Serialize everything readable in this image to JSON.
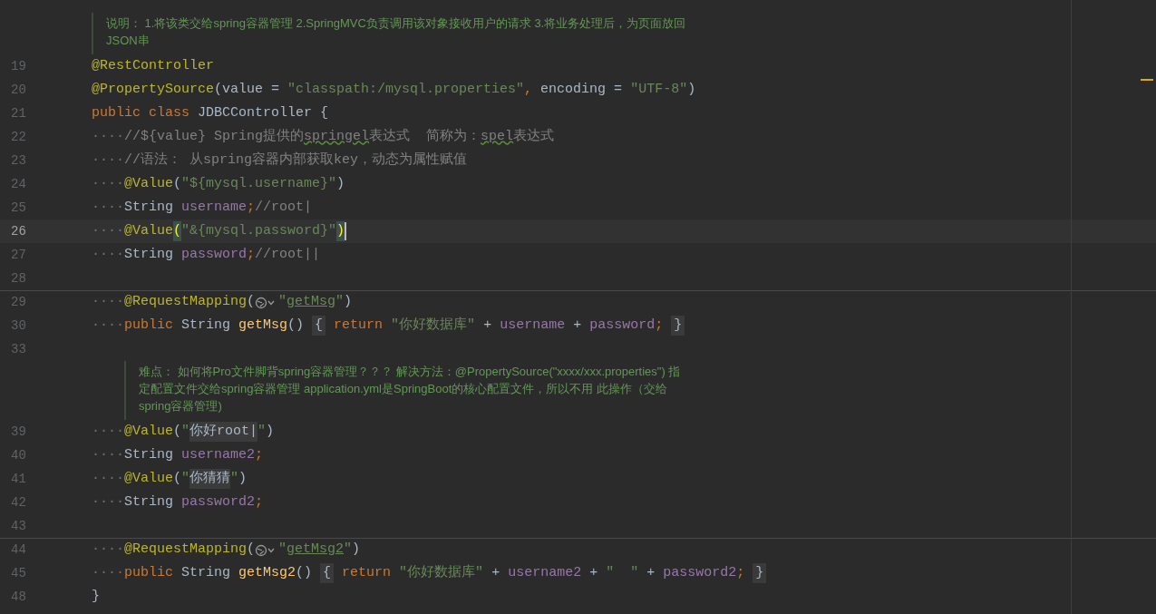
{
  "lines": [
    {
      "kind": "doc",
      "nested": false,
      "text": "说明： 1.将该类交给spring容器管理 2.SpringMVC负责调用该对象接收用户的请求 3.将业务处理后，为页面放回JSON串"
    },
    {
      "kind": "code",
      "number": "19",
      "tokens": [
        {
          "kind": "annotation",
          "text": "@RestController"
        }
      ]
    },
    {
      "kind": "code",
      "number": "20",
      "tokens": [
        {
          "kind": "annotation",
          "text": "@PropertySource"
        },
        {
          "kind": "plain",
          "text": "(value = "
        },
        {
          "kind": "string",
          "text": "\"classpath:/mysql.properties\""
        },
        {
          "kind": "keyword",
          "text": ","
        },
        {
          "kind": "plain",
          "text": " encoding = "
        },
        {
          "kind": "string",
          "text": "\"UTF-8\""
        },
        {
          "kind": "plain",
          "text": ")"
        }
      ]
    },
    {
      "kind": "code",
      "number": "21",
      "tokens": [
        {
          "kind": "keyword",
          "text": "public class "
        },
        {
          "kind": "plain",
          "text": "JDBCController {"
        }
      ]
    },
    {
      "kind": "code",
      "number": "22",
      "tokens": [
        {
          "kind": "ws",
          "text": "····"
        },
        {
          "kind": "comment",
          "text": "//${value} Spring提供的"
        },
        {
          "kind": "typo",
          "text": "springel"
        },
        {
          "kind": "comment",
          "text": "表达式  简称为："
        },
        {
          "kind": "typo",
          "text": "spel"
        },
        {
          "kind": "comment",
          "text": "表达式"
        }
      ]
    },
    {
      "kind": "code",
      "number": "23",
      "tokens": [
        {
          "kind": "ws",
          "text": "····"
        },
        {
          "kind": "comment",
          "text": "//语法： 从spring容器内部获取key，动态为属性赋值"
        }
      ]
    },
    {
      "kind": "code",
      "number": "24",
      "tokens": [
        {
          "kind": "ws",
          "text": "····"
        },
        {
          "kind": "annotation",
          "text": "@Value"
        },
        {
          "kind": "plain",
          "text": "("
        },
        {
          "kind": "string",
          "text": "\"${mysql.username}\""
        },
        {
          "kind": "plain",
          "text": ")"
        }
      ]
    },
    {
      "kind": "code",
      "number": "25",
      "tokens": [
        {
          "kind": "ws",
          "text": "····"
        },
        {
          "kind": "plain",
          "text": "String "
        },
        {
          "kind": "field",
          "text": "username"
        },
        {
          "kind": "keyword",
          "text": ";"
        },
        {
          "kind": "comment",
          "text": "//root|"
        }
      ]
    },
    {
      "kind": "code",
      "number": "26",
      "current": true,
      "tokens": [
        {
          "kind": "ws",
          "text": "····"
        },
        {
          "kind": "annotation",
          "text": "@Value"
        },
        {
          "kind": "match",
          "text": "("
        },
        {
          "kind": "string",
          "text": "\"&{mysql.password}\""
        },
        {
          "kind": "match",
          "text": ")"
        }
      ]
    },
    {
      "kind": "code",
      "number": "27",
      "tokens": [
        {
          "kind": "ws",
          "text": "····"
        },
        {
          "kind": "plain",
          "text": "String "
        },
        {
          "kind": "field",
          "text": "password"
        },
        {
          "kind": "keyword",
          "text": ";"
        },
        {
          "kind": "comment",
          "text": "//root||"
        }
      ]
    },
    {
      "kind": "code",
      "number": "28"
    },
    {
      "kind": "code",
      "number": "29",
      "separator": true,
      "tokens": [
        {
          "kind": "ws",
          "text": "····"
        },
        {
          "kind": "annotation",
          "text": "@RequestMapping"
        },
        {
          "kind": "plain",
          "text": "("
        },
        {
          "kind": "globe"
        },
        {
          "kind": "string",
          "text": "\""
        },
        {
          "kind": "link",
          "text": "getMsg"
        },
        {
          "kind": "string",
          "text": "\""
        },
        {
          "kind": "plain",
          "text": ")"
        }
      ]
    },
    {
      "kind": "code",
      "number": "30",
      "tokens": [
        {
          "kind": "ws",
          "text": "····"
        },
        {
          "kind": "keyword",
          "text": "public "
        },
        {
          "kind": "plain",
          "text": "String "
        },
        {
          "kind": "method",
          "text": "getMsg"
        },
        {
          "kind": "plain",
          "text": "() "
        },
        {
          "kind": "fold",
          "text": "{"
        },
        {
          "kind": "keyword",
          "text": " return "
        },
        {
          "kind": "string",
          "text": "\"你好数据库\""
        },
        {
          "kind": "plain",
          "text": " + "
        },
        {
          "kind": "field",
          "text": "username"
        },
        {
          "kind": "plain",
          "text": " + "
        },
        {
          "kind": "field",
          "text": "password"
        },
        {
          "kind": "keyword",
          "text": "; "
        },
        {
          "kind": "fold",
          "text": "}"
        }
      ]
    },
    {
      "kind": "code",
      "number": "33"
    },
    {
      "kind": "doc",
      "nested": true,
      "text": "难点： 如何将Pro文件脚背spring容器管理？？？ 解决方法：@PropertySource(\"xxxx/xxx.properties\") 指定配置文件交给spring容器管理 application.yml是SpringBoot的核心配置文件，所以不用 此操作（交给spring容器管理)"
    },
    {
      "kind": "code",
      "number": "39",
      "tokens": [
        {
          "kind": "ws",
          "text": "····"
        },
        {
          "kind": "annotation",
          "text": "@Value"
        },
        {
          "kind": "plain",
          "text": "("
        },
        {
          "kind": "string",
          "text": "\""
        },
        {
          "kind": "injected",
          "text": "你好root|"
        },
        {
          "kind": "string",
          "text": "\""
        },
        {
          "kind": "plain",
          "text": ")"
        }
      ]
    },
    {
      "kind": "code",
      "number": "40",
      "tokens": [
        {
          "kind": "ws",
          "text": "····"
        },
        {
          "kind": "plain",
          "text": "String "
        },
        {
          "kind": "field",
          "text": "username2"
        },
        {
          "kind": "keyword",
          "text": ";"
        }
      ]
    },
    {
      "kind": "code",
      "number": "41",
      "tokens": [
        {
          "kind": "ws",
          "text": "····"
        },
        {
          "kind": "annotation",
          "text": "@Value"
        },
        {
          "kind": "plain",
          "text": "("
        },
        {
          "kind": "string",
          "text": "\""
        },
        {
          "kind": "injected",
          "text": "你猜猜"
        },
        {
          "kind": "string",
          "text": "\""
        },
        {
          "kind": "plain",
          "text": ")"
        }
      ]
    },
    {
      "kind": "code",
      "number": "42",
      "tokens": [
        {
          "kind": "ws",
          "text": "····"
        },
        {
          "kind": "plain",
          "text": "String "
        },
        {
          "kind": "field",
          "text": "password2"
        },
        {
          "kind": "keyword",
          "text": ";"
        }
      ]
    },
    {
      "kind": "code",
      "number": "43"
    },
    {
      "kind": "code",
      "number": "44",
      "separator": true,
      "tokens": [
        {
          "kind": "ws",
          "text": "····"
        },
        {
          "kind": "annotation",
          "text": "@RequestMapping"
        },
        {
          "kind": "plain",
          "text": "("
        },
        {
          "kind": "globe"
        },
        {
          "kind": "string",
          "text": "\""
        },
        {
          "kind": "link",
          "text": "getMsg2"
        },
        {
          "kind": "string",
          "text": "\""
        },
        {
          "kind": "plain",
          "text": ")"
        }
      ]
    },
    {
      "kind": "code",
      "number": "45",
      "tokens": [
        {
          "kind": "ws",
          "text": "····"
        },
        {
          "kind": "keyword",
          "text": "public "
        },
        {
          "kind": "plain",
          "text": "String "
        },
        {
          "kind": "method",
          "text": "getMsg2"
        },
        {
          "kind": "plain",
          "text": "() "
        },
        {
          "kind": "fold",
          "text": "{"
        },
        {
          "kind": "keyword",
          "text": " return "
        },
        {
          "kind": "string",
          "text": "\"你好数据库\""
        },
        {
          "kind": "plain",
          "text": " + "
        },
        {
          "kind": "field",
          "text": "username2"
        },
        {
          "kind": "plain",
          "text": " + "
        },
        {
          "kind": "string",
          "text": "\"  \""
        },
        {
          "kind": "plain",
          "text": " + "
        },
        {
          "kind": "field",
          "text": "password2"
        },
        {
          "kind": "keyword",
          "text": "; "
        },
        {
          "kind": "fold",
          "text": "}"
        }
      ]
    },
    {
      "kind": "code",
      "number": "48",
      "tokens": [
        {
          "kind": "plain",
          "text": "}"
        }
      ]
    }
  ]
}
